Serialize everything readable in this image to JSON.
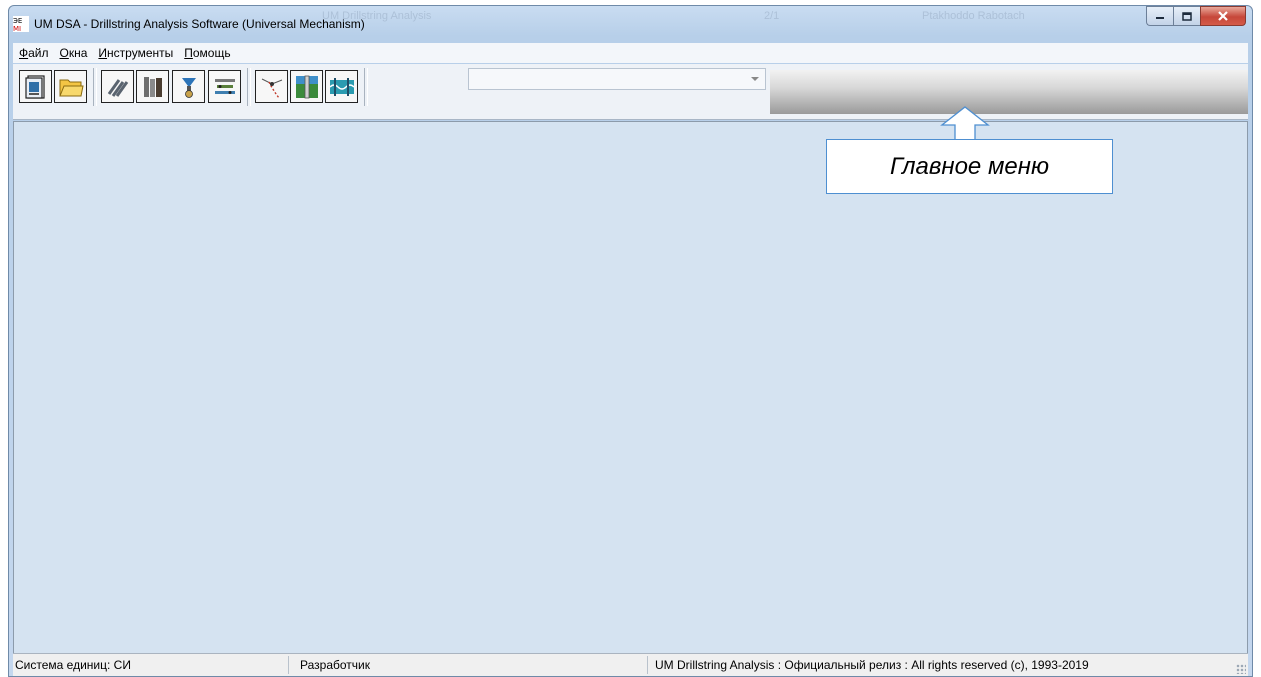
{
  "window": {
    "title": "UM DSA - Drillstring Analysis Software (Universal Mechanism)",
    "ghost_titles": [
      "UM Drillstring Analysis",
      "2/1",
      "Ptakhoddo Rabotach"
    ]
  },
  "menu": {
    "items": [
      {
        "accel": "Ф",
        "rest": "айл"
      },
      {
        "accel": "О",
        "rest": "кна"
      },
      {
        "accel": "И",
        "rest": "нструменты"
      },
      {
        "accel": "П",
        "rest": "омощь"
      }
    ]
  },
  "toolbar": {
    "buttons": [
      {
        "name": "new-document-icon"
      },
      {
        "name": "open-folder-icon"
      },
      {
        "name": "drill-pipe-icon"
      },
      {
        "name": "drill-collars-icon"
      },
      {
        "name": "bit-icon"
      },
      {
        "name": "bha-assembly-icon"
      },
      {
        "name": "well-trajectory-icon"
      },
      {
        "name": "wellbore-section-icon"
      },
      {
        "name": "drillstring-vibration-icon"
      }
    ],
    "combo_value": ""
  },
  "status": {
    "units": "Система единиц: СИ",
    "mode": "Разработчик",
    "release": "UM Drillstring Analysis : Официальный релиз : All rights reserved (c), 1993-2019"
  },
  "annotation": {
    "label": "Главное меню"
  },
  "colors": {
    "client_bg": "#d5e3f1",
    "annotation_border": "#4e8fd1",
    "close_button": "#c6473a"
  }
}
